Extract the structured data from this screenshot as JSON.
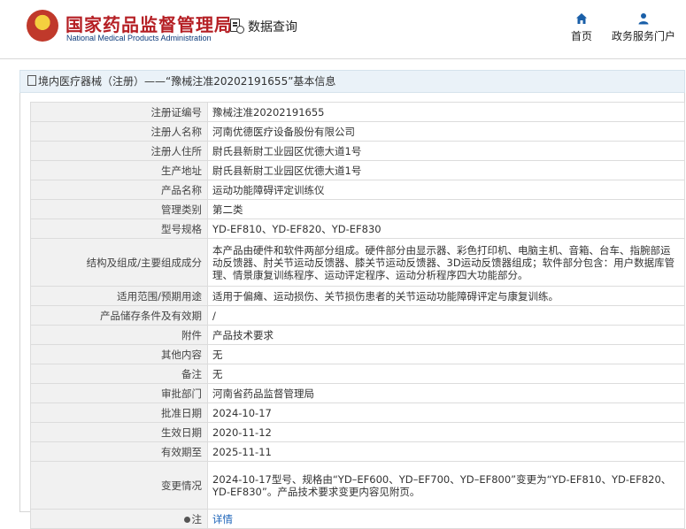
{
  "header": {
    "site_title": "国家药品监督管理局",
    "site_subtitle": "National Medical Products Administration",
    "query_label": "数据查询",
    "nav": [
      {
        "label": "首页",
        "icon": "home-icon"
      },
      {
        "label": "政务服务门户",
        "icon": "user-icon"
      }
    ]
  },
  "breadcrumb": "境内医疗器械（注册）——“豫械注准20202191655”基本信息",
  "rows": [
    {
      "label": "注册证编号",
      "value": "豫械注准20202191655"
    },
    {
      "label": "注册人名称",
      "value": "河南优德医疗设备股份有限公司"
    },
    {
      "label": "注册人住所",
      "value": "尉氏县新尉工业园区优德大道1号"
    },
    {
      "label": "生产地址",
      "value": "尉氏县新尉工业园区优德大道1号"
    },
    {
      "label": "产品名称",
      "value": "运动功能障碍评定训练仪"
    },
    {
      "label": "管理类别",
      "value": "第二类"
    },
    {
      "label": "型号规格",
      "value": "YD-EF810、YD-EF820、YD-EF830"
    },
    {
      "label": "结构及组成/主要组成成分",
      "value": "本产品由硬件和软件两部分组成。硬件部分由显示器、彩色打印机、电脑主机、音箱、台车、指腕部运动反馈器、肘关节运动反馈器、膝关节运动反馈器、3D运动反馈器组成；软件部分包含：用户数据库管理、情景康复训练程序、运动评定程序、运动分析程序四大功能部分。"
    },
    {
      "label": "适用范围/预期用途",
      "value": "适用于偏瘫、运动损伤、关节损伤患者的关节运动功能障碍评定与康复训练。"
    },
    {
      "label": "产品储存条件及有效期",
      "value": "/"
    },
    {
      "label": "附件",
      "value": "产品技术要求"
    },
    {
      "label": "其他内容",
      "value": "无"
    },
    {
      "label": "备注",
      "value": "无"
    },
    {
      "label": "审批部门",
      "value": "河南省药品监督管理局"
    },
    {
      "label": "批准日期",
      "value": "2024-10-17"
    },
    {
      "label": "生效日期",
      "value": "2020-11-12"
    },
    {
      "label": "有效期至",
      "value": "2025-11-11"
    },
    {
      "label": "变更情况",
      "value": "2024-10-17型号、规格由“YD–EF600、YD–EF700、YD–EF800”变更为“YD-EF810、YD-EF820、YD-EF830”。产品技术要求变更内容见附页。"
    }
  ],
  "note": {
    "label": "注",
    "link": "详情"
  }
}
